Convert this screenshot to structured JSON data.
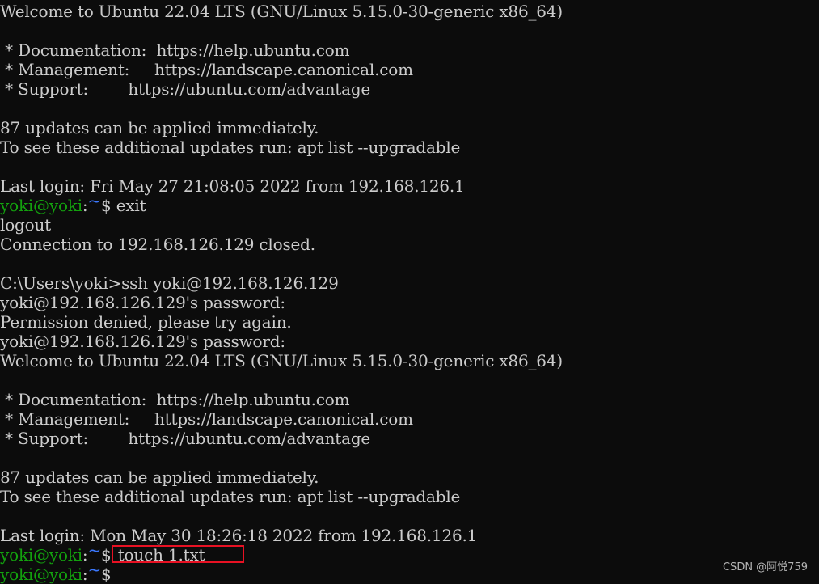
{
  "terminal": {
    "lines": [
      {
        "type": "text",
        "text": "Welcome to Ubuntu 22.04 LTS (GNU/Linux 5.15.0-30-generic x86_64)"
      },
      {
        "type": "text",
        "text": ""
      },
      {
        "type": "text",
        "text": " * Documentation:  https://help.ubuntu.com"
      },
      {
        "type": "text",
        "text": " * Management:     https://landscape.canonical.com"
      },
      {
        "type": "text",
        "text": " * Support:        https://ubuntu.com/advantage"
      },
      {
        "type": "text",
        "text": ""
      },
      {
        "type": "text",
        "text": "87 updates can be applied immediately."
      },
      {
        "type": "text",
        "text": "To see these additional updates run: apt list --upgradable"
      },
      {
        "type": "text",
        "text": ""
      },
      {
        "type": "text",
        "text": "Last login: Fri May 27 21:08:05 2022 from 192.168.126.1"
      },
      {
        "type": "prompt",
        "user": "yoki@yoki",
        "sep": ":",
        "dir": "~",
        "symbol": "$",
        "command": " exit"
      },
      {
        "type": "text",
        "text": "logout"
      },
      {
        "type": "text",
        "text": "Connection to 192.168.126.129 closed."
      },
      {
        "type": "text",
        "text": ""
      },
      {
        "type": "text",
        "text": "C:\\Users\\yoki>ssh yoki@192.168.126.129"
      },
      {
        "type": "text",
        "text": "yoki@192.168.126.129's password:"
      },
      {
        "type": "text",
        "text": "Permission denied, please try again."
      },
      {
        "type": "text",
        "text": "yoki@192.168.126.129's password:"
      },
      {
        "type": "text",
        "text": "Welcome to Ubuntu 22.04 LTS (GNU/Linux 5.15.0-30-generic x86_64)"
      },
      {
        "type": "text",
        "text": ""
      },
      {
        "type": "text",
        "text": " * Documentation:  https://help.ubuntu.com"
      },
      {
        "type": "text",
        "text": " * Management:     https://landscape.canonical.com"
      },
      {
        "type": "text",
        "text": " * Support:        https://ubuntu.com/advantage"
      },
      {
        "type": "text",
        "text": ""
      },
      {
        "type": "text",
        "text": "87 updates can be applied immediately."
      },
      {
        "type": "text",
        "text": "To see these additional updates run: apt list --upgradable"
      },
      {
        "type": "text",
        "text": ""
      },
      {
        "type": "text",
        "text": "Last login: Mon May 30 18:26:18 2022 from 192.168.126.1"
      },
      {
        "type": "prompt",
        "user": "yoki@yoki",
        "sep": ":",
        "dir": "~",
        "symbol": "$",
        "command": " touch 1.txt",
        "highlight": true
      },
      {
        "type": "prompt",
        "user": "yoki@yoki",
        "sep": ":",
        "dir": "~",
        "symbol": "$",
        "command": ""
      }
    ]
  },
  "colors": {
    "background": "#0c0c0c",
    "foreground": "#cccccc",
    "user": "#13a10e",
    "dir": "#3b78ff",
    "highlight_box": "#e81123"
  },
  "watermark": "CSDN @阿悦759"
}
